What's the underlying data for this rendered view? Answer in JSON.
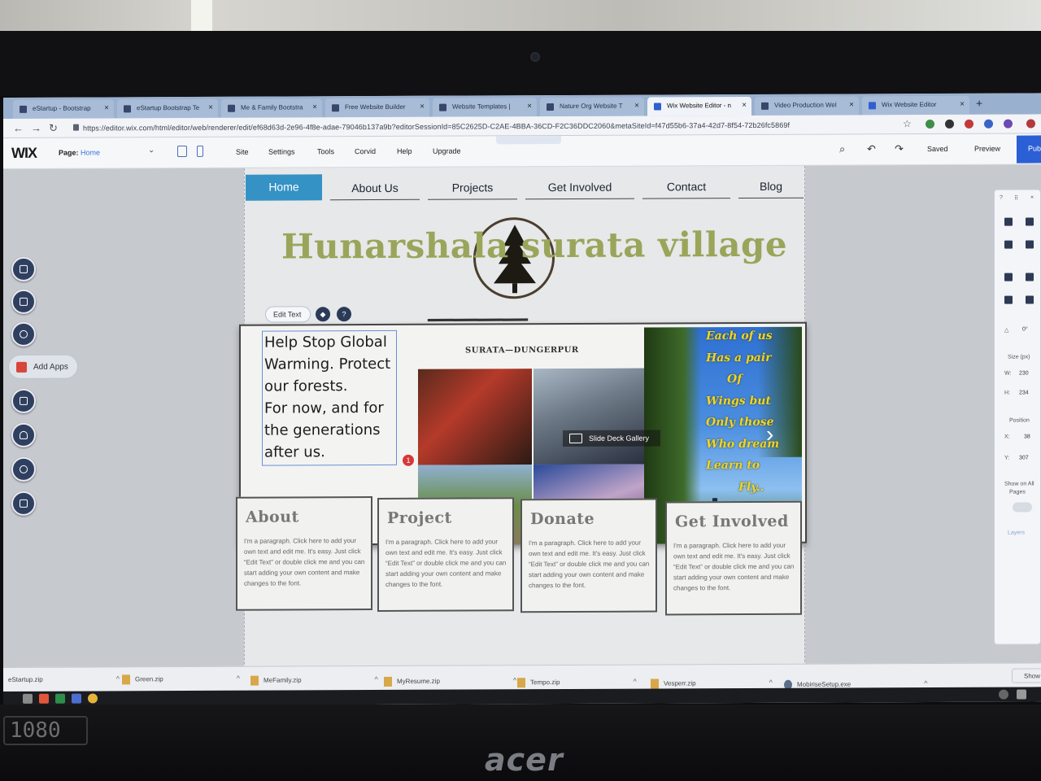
{
  "browser": {
    "tabs": [
      {
        "label": "eStartup - Bootstrap",
        "active": false
      },
      {
        "label": "eStartup Bootstrap Te",
        "active": false
      },
      {
        "label": "Me & Family Bootstra",
        "active": false
      },
      {
        "label": "Free Website Builder",
        "active": false
      },
      {
        "label": "Website Templates |",
        "active": false
      },
      {
        "label": "Nature Org Website T",
        "active": false
      },
      {
        "label": "Wix Website Editor - n",
        "active": true
      },
      {
        "label": "Video Production Wel",
        "active": false
      },
      {
        "label": "Wix Website Editor",
        "active": false
      }
    ],
    "url": "https://editor.wix.com/html/editor/web/renderer/edit/ef68d63d-2e96-4f8e-adae-79046b137a9b?editorSessionId=85C2625D-C2AE-4BBA-36CD-F2C36DDC2060&metaSiteId=f47d55b6-37a4-42d7-8f54-72b26fc5869f",
    "new_tab": "+"
  },
  "wix": {
    "logo": "WIX",
    "page_label": "Page:",
    "page_name": "Home",
    "menu": [
      "Site",
      "Settings",
      "Tools",
      "Corvid",
      "Help",
      "Upgrade"
    ],
    "saved": "Saved",
    "preview": "Preview",
    "publish": "Pub",
    "add_apps": "Add Apps",
    "edit_text": "Edit Text"
  },
  "site": {
    "nav": [
      "Home",
      "About Us",
      "Projects",
      "Get Involved",
      "Contact",
      "Blog"
    ],
    "title": "Hunarshala surata village",
    "location": "SURATA—DUNGERPUR",
    "text_box_lines": [
      "Help Stop Global",
      "Warming. Protect",
      "our forests.",
      "For now, and for",
      "the generations",
      "after us."
    ],
    "badge": "1",
    "gallery_label": "Slide Deck Gallery",
    "poem_lines": [
      "Each of us",
      "Has a pair",
      "Of",
      "Wings but",
      "Only those",
      "Who dream",
      "Learn to",
      "Fly.."
    ],
    "cards": [
      {
        "title": "About",
        "body": "I'm a paragraph. Click here to add your own text and edit me. It's easy. Just click “Edit Text” or double click me and you can start adding your own content and make changes to the font."
      },
      {
        "title": "Project",
        "body": "I'm a paragraph. Click here to add your own text and edit me. It's easy. Just click “Edit Text” or double click me and you can start adding your own content and make changes to the font."
      },
      {
        "title": "Donate",
        "body": "I'm a paragraph. Click here to add your own text and edit me. It's easy. Just click “Edit Text” or double click me and you can start adding your own content and make changes to the font."
      },
      {
        "title": "Get Involved",
        "body": "I'm a paragraph. Click here to add your own text and edit me. It's easy. Just click “Edit Text” or double click me and you can start adding your own content and make changes to the font."
      }
    ]
  },
  "inspector": {
    "rotation": "0°",
    "size_label": "Size (px)",
    "w_label": "W:",
    "w_value": "230",
    "h_label": "H:",
    "h_value": "234",
    "position_label": "Position",
    "x_label": "X:",
    "x_value": "38",
    "y_label": "Y:",
    "y_value": "307",
    "show_on_all": "Show on All",
    "pages": "Pages",
    "layers": "Layers"
  },
  "downloads": [
    "eStartup.zip",
    "Green.zip",
    "MeFamily.zip",
    "MyResume.zip",
    "Tempo.zip",
    "Vesperr.zip",
    "MobiriseSetup.exe"
  ],
  "downloads_show_all": "Show",
  "hardware": {
    "sticker": "1080",
    "brand": "acer"
  },
  "colors": {
    "nav_active": "#3592c4",
    "title_green": "#9aa55a",
    "poem_yellow": "#f2d32a",
    "wix_blue": "#2b5fd6"
  }
}
